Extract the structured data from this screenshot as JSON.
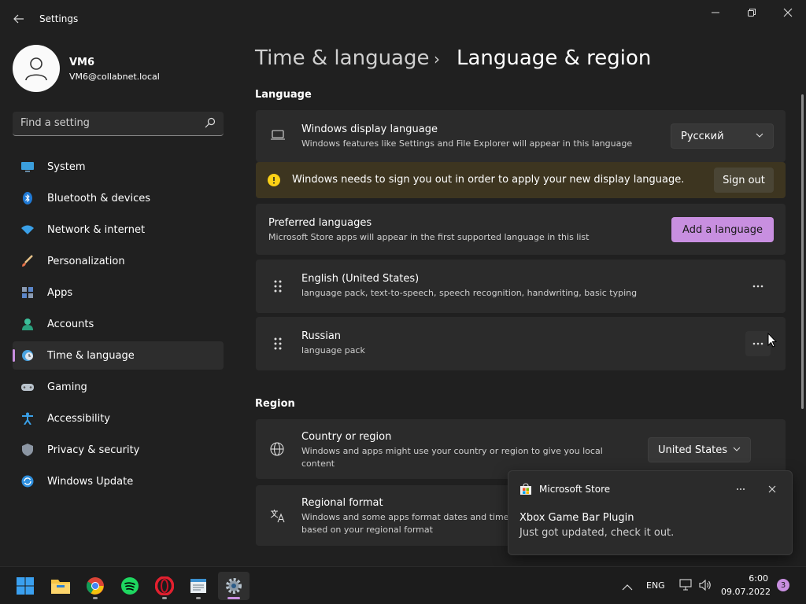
{
  "window": {
    "title": "Settings"
  },
  "user": {
    "name": "VM6",
    "email": "VM6@collabnet.local"
  },
  "search": {
    "placeholder": "Find a setting"
  },
  "nav": [
    {
      "label": "System",
      "icon": "monitor-icon"
    },
    {
      "label": "Bluetooth & devices",
      "icon": "bluetooth-icon"
    },
    {
      "label": "Network & internet",
      "icon": "wifi-icon"
    },
    {
      "label": "Personalization",
      "icon": "brush-icon"
    },
    {
      "label": "Apps",
      "icon": "apps-icon"
    },
    {
      "label": "Accounts",
      "icon": "person-icon"
    },
    {
      "label": "Time & language",
      "icon": "clock-globe-icon",
      "active": true
    },
    {
      "label": "Gaming",
      "icon": "gamepad-icon"
    },
    {
      "label": "Accessibility",
      "icon": "accessibility-icon"
    },
    {
      "label": "Privacy & security",
      "icon": "shield-icon"
    },
    {
      "label": "Windows Update",
      "icon": "update-icon"
    }
  ],
  "breadcrumb": {
    "parent": "Time & language",
    "separator": "›",
    "current": "Language & region"
  },
  "language": {
    "section_title": "Language",
    "display_language": {
      "title": "Windows display language",
      "description": "Windows features like Settings and File Explorer will appear in this language",
      "value": "Русский"
    },
    "warning": {
      "text": "Windows needs to sign you out in order to apply your new display language.",
      "button": "Sign out",
      "color": "#3d3520"
    },
    "preferred": {
      "title": "Preferred languages",
      "description": "Microsoft Store apps will appear in the first supported language in this list",
      "button": "Add a language"
    },
    "languages": [
      {
        "name": "English (United States)",
        "features": "language pack, text-to-speech, speech recognition, handwriting, basic typing"
      },
      {
        "name": "Russian",
        "features": "language pack"
      }
    ]
  },
  "region": {
    "section_title": "Region",
    "country": {
      "title": "Country or region",
      "description": "Windows and apps might use your country or region to give you local content",
      "value": "United States"
    },
    "format": {
      "title": "Regional format",
      "description": "Windows and some apps format dates and times based on your regional format"
    }
  },
  "toast": {
    "app": "Microsoft Store",
    "title": "Xbox Game Bar Plugin",
    "body": "Just got updated, check it out."
  },
  "taskbar": {
    "apps": [
      "windows-start-icon",
      "file-explorer-icon",
      "chrome-icon",
      "spotify-icon",
      "opera-icon",
      "notepad-icon",
      "settings-icon"
    ],
    "language": "ENG",
    "time": "6:00",
    "date": "09.07.2022",
    "notification_count": "3"
  },
  "colors": {
    "accent": "#c88fe0",
    "background": "#202020",
    "card": "#2b2b2b",
    "warning_icon": "#fcd116"
  }
}
